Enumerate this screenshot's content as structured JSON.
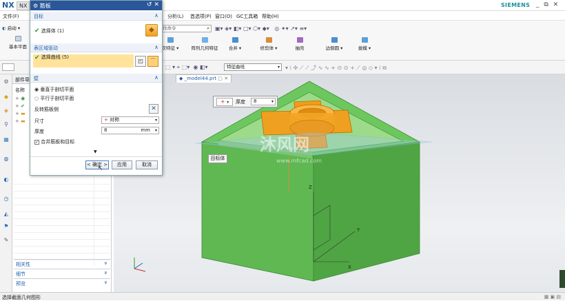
{
  "app": {
    "logo": "NX",
    "tab_label": "NX",
    "brand": "SIEMENS",
    "window_controls": "_ ⧉ ✕"
  },
  "menu": [
    "文件(F)",
    "分析(L)",
    "首选项(P)",
    "窗口(O)",
    "GC工具箱",
    "帮助(H)"
  ],
  "ribbon": {
    "left_buttons": [
      {
        "label": "启动"
      },
      {
        "label": "基本平面"
      }
    ],
    "search_placeholder": "找命令",
    "groups": [
      {
        "label": "次特征"
      },
      {
        "label": "阵列几何特征"
      },
      {
        "label": "合并"
      },
      {
        "label": "修剪体"
      },
      {
        "label": "抽壳"
      },
      {
        "label": "边倒圆"
      },
      {
        "label": "拔模"
      }
    ]
  },
  "selection_bar": {
    "curve_filter": "特征曲线"
  },
  "navigator": {
    "title": "部件导",
    "column_name": "名称",
    "accordions": [
      "相关性",
      "细节",
      "预览"
    ]
  },
  "file_tab": {
    "label": "_model44.prt"
  },
  "dialog": {
    "title": "筋板",
    "section_target": "目标",
    "select_body_label": "选择体 (1)",
    "section_region": "表区域驱动",
    "select_curve_label": "选择曲线 (5)",
    "section_wall": "壁",
    "radio_perpendicular": "垂直于剖切平面",
    "radio_parallel": "平行于剖切平面",
    "reverse_label": "反转筋板侧",
    "size_label": "尺寸",
    "size_value": "对称",
    "thickness_label": "厚度",
    "thickness_value": "8",
    "thickness_unit": "mm",
    "merge_label": "合并筋板和目标",
    "merge_checked": true,
    "ok_button": "< 确定 >",
    "apply_button": "应用",
    "cancel_button": "取消"
  },
  "scene": {
    "thickness_widget": {
      "label": "厚度",
      "value": "8"
    },
    "target_tag": "目标体",
    "watermark": "沐风网",
    "watermark_url": "www.mfcad.com",
    "axes": {
      "x": "X",
      "y": "Y",
      "z": "Z"
    }
  },
  "status_bar": {
    "text": "选择截面几何图形"
  },
  "colors": {
    "title_blue": "#2b579a",
    "accent": "#1f5fa8",
    "box_green": "#5fb852",
    "rib_orange": "#f0a020",
    "highlight_yellow": "#ffe39a"
  }
}
